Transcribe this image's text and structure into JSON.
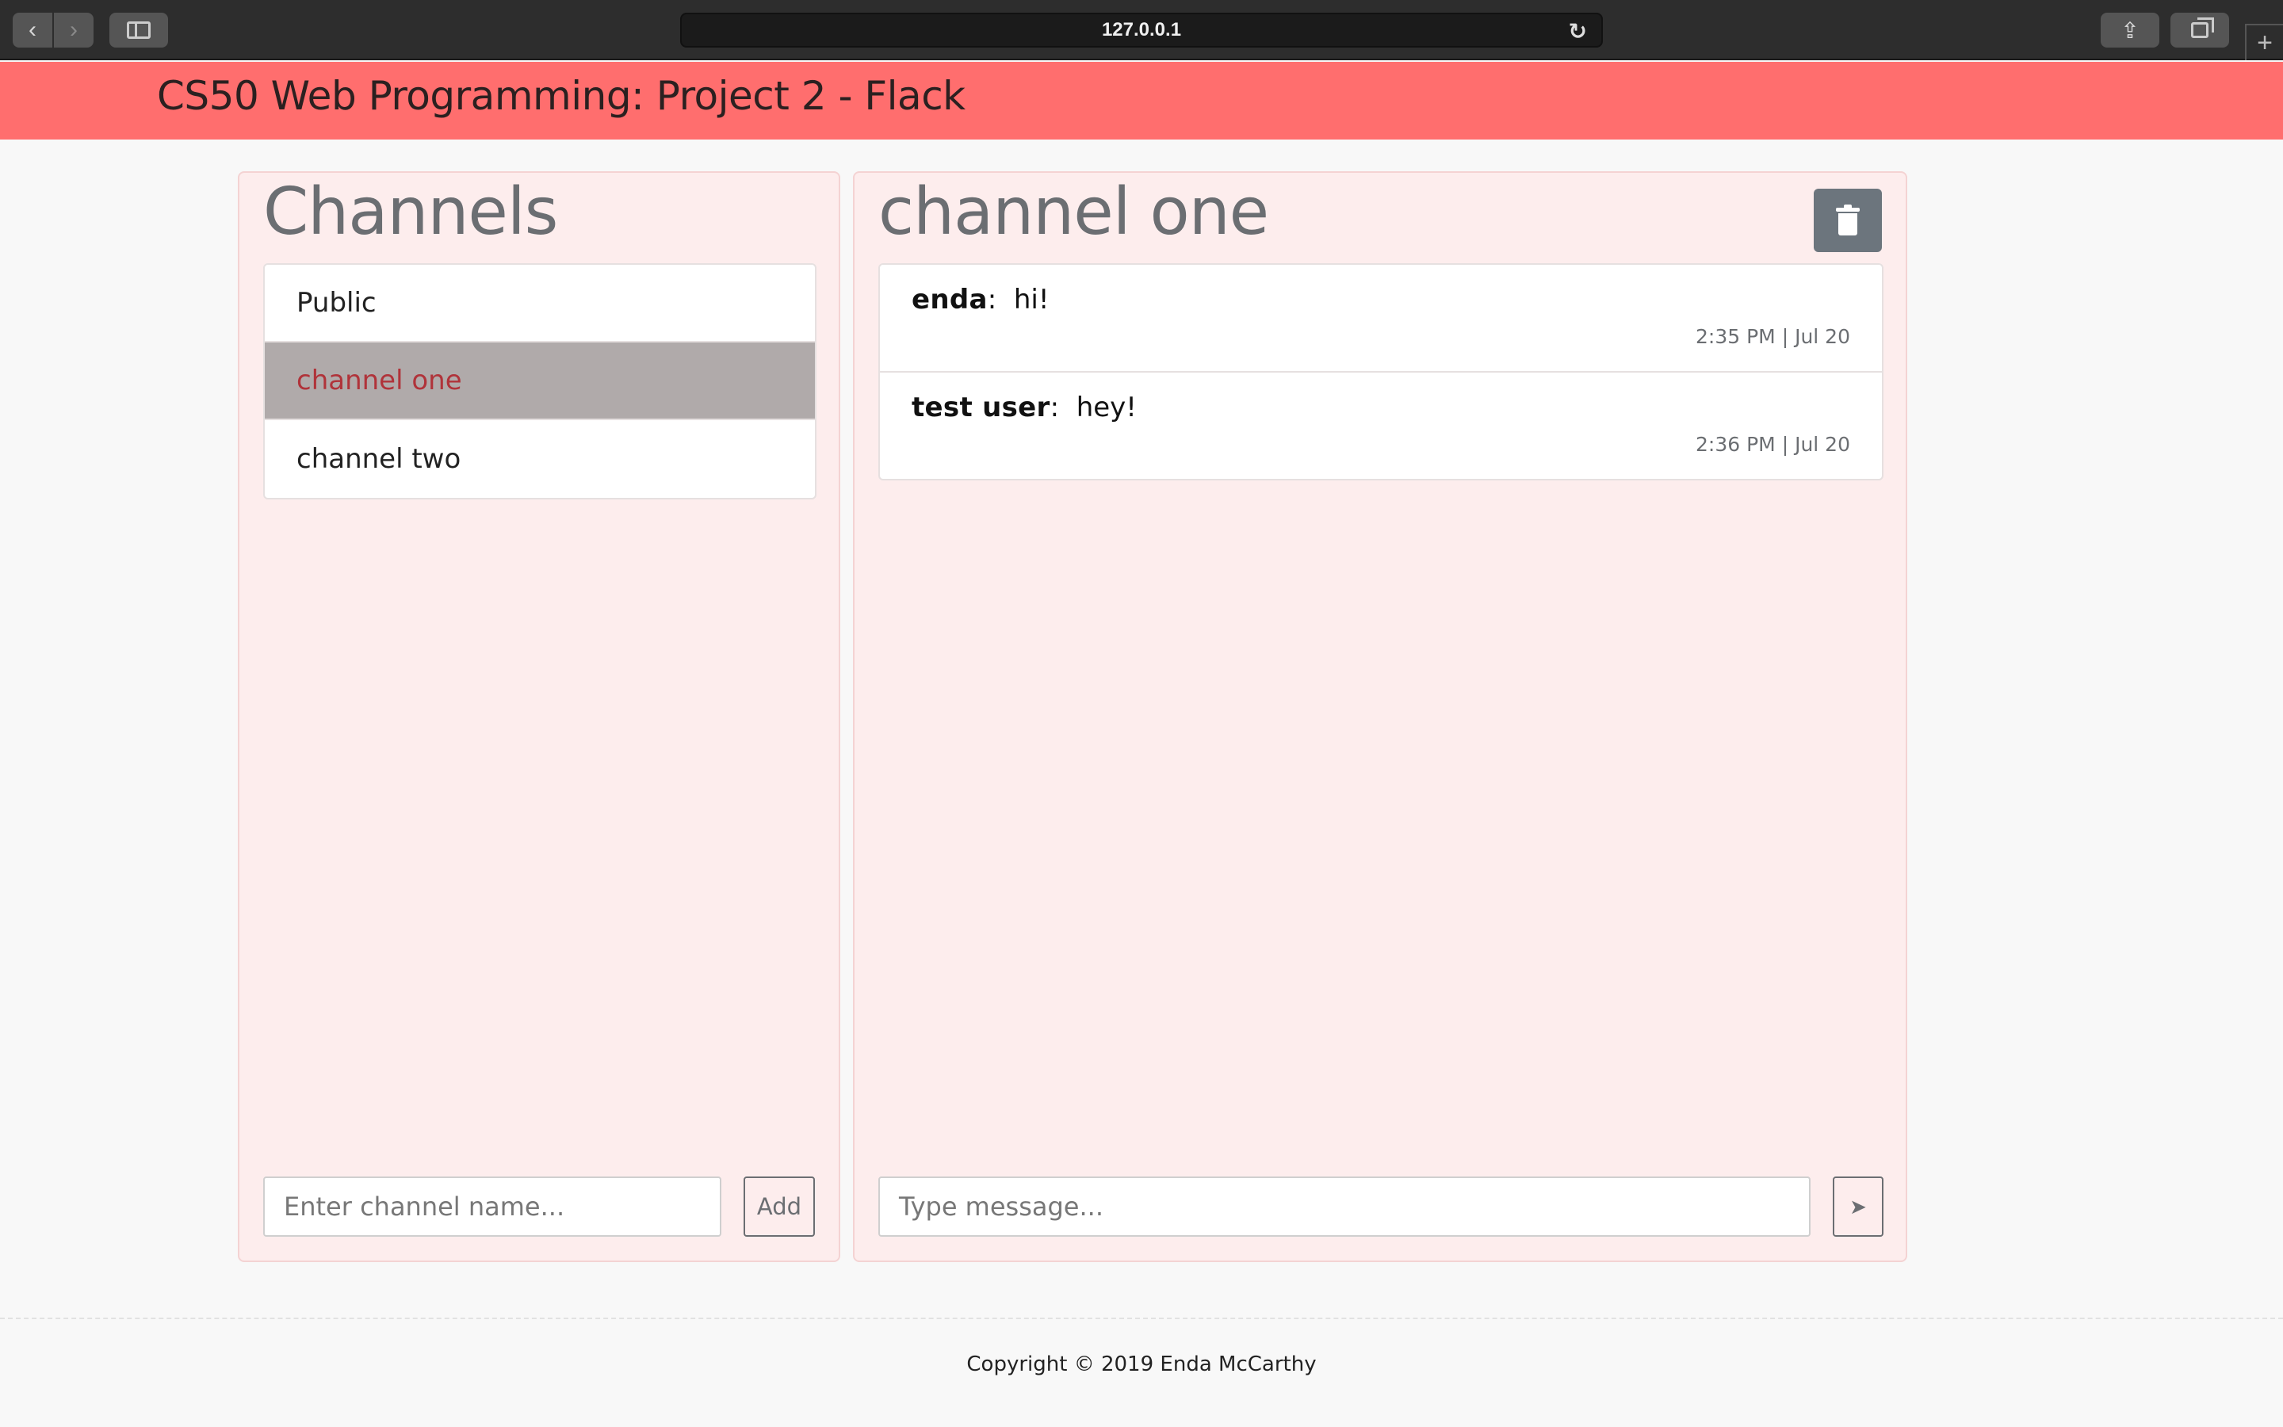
{
  "browser": {
    "url": "127.0.0.1",
    "back_icon": "chevron-left-icon",
    "forward_icon": "chevron-right-icon",
    "share_icon": "share-icon",
    "reload_icon": "reload-icon",
    "new_tab_label": "+"
  },
  "header": {
    "title": "CS50 Web Programming: Project 2 - Flack",
    "background_color": "#ff6e6e"
  },
  "channels": {
    "title": "Channels",
    "items": [
      {
        "label": "Public",
        "active": false
      },
      {
        "label": "channel one",
        "active": true
      },
      {
        "label": "channel two",
        "active": false
      }
    ],
    "input_placeholder": "Enter channel name...",
    "add_label": "Add"
  },
  "chat": {
    "title": "channel one",
    "delete_icon": "trash-icon",
    "messages": [
      {
        "author": "enda",
        "text": "hi!",
        "time": "2:35 PM | Jul 20"
      },
      {
        "author": "test user",
        "text": "hey!",
        "time": "2:36 PM | Jul 20"
      }
    ],
    "input_placeholder": "Type message...",
    "send_icon": "send-icon",
    "send_glyph": "➤"
  },
  "footer": {
    "copyright": "Copyright © 2019 Enda McCarthy"
  }
}
